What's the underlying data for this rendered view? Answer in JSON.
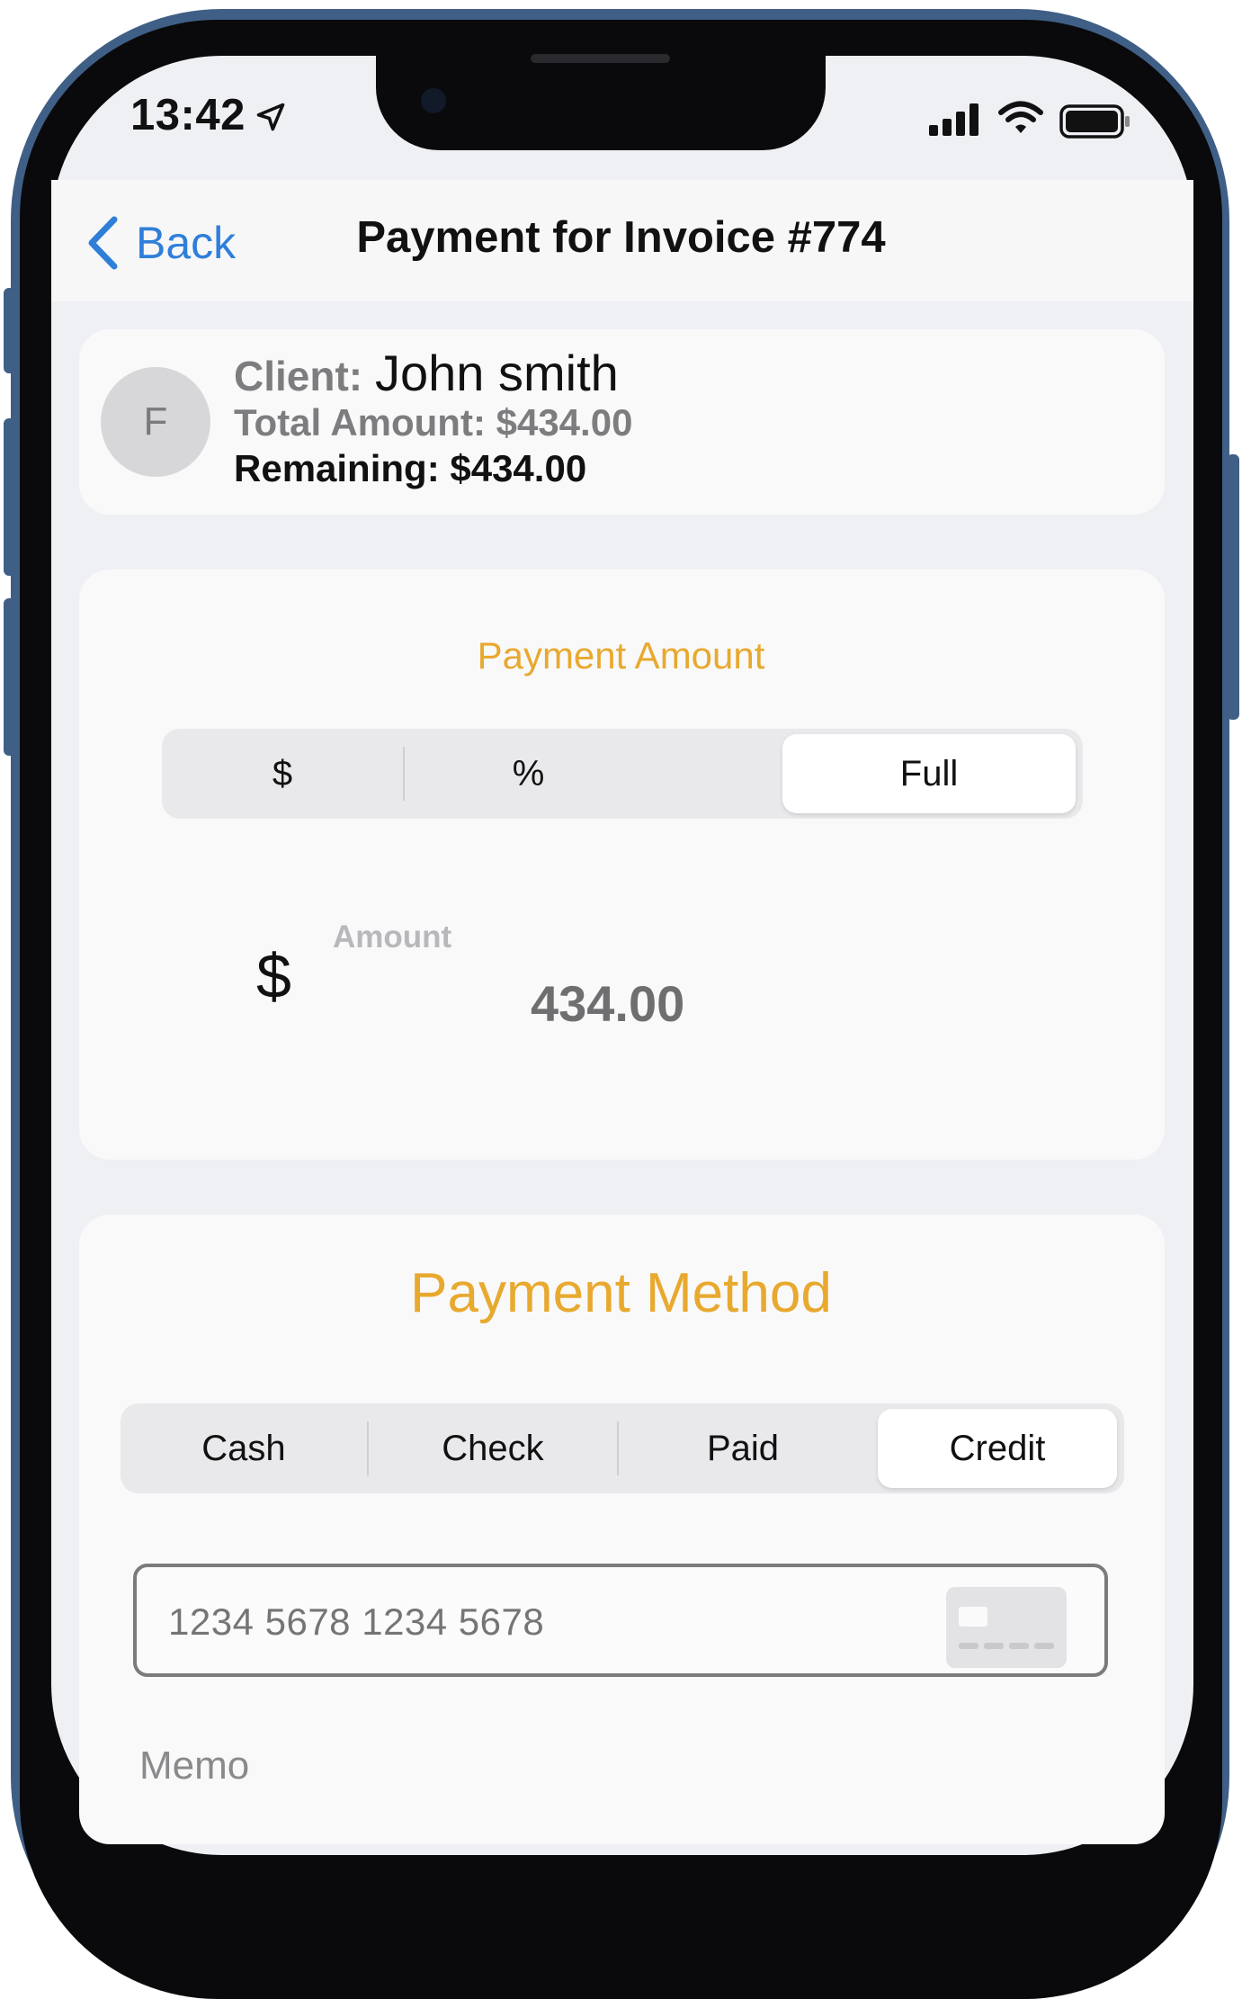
{
  "status_bar": {
    "time": "13:42",
    "icons": [
      "location-arrow-icon",
      "cellular-signal-icon",
      "wifi-icon",
      "battery-icon"
    ]
  },
  "nav": {
    "back_label": "Back",
    "title": "Payment for Invoice #774"
  },
  "client": {
    "avatar_initial": "F",
    "client_label": "Client:",
    "client_name": "John smith",
    "total_label": "Total Amount:",
    "total_value": "$434.00",
    "remaining_label": "Remaining:",
    "remaining_value": "$434.00"
  },
  "payment_amount": {
    "title": "Payment Amount",
    "options": [
      {
        "label": "$",
        "selected": false
      },
      {
        "label": "%",
        "selected": false
      },
      {
        "label": "Full",
        "selected": true
      }
    ],
    "currency_symbol": "$",
    "amount_label": "Amount",
    "amount_value": "434.00"
  },
  "payment_method": {
    "title": "Payment Method",
    "options": [
      {
        "label": "Cash",
        "selected": false
      },
      {
        "label": "Check",
        "selected": false
      },
      {
        "label": "Paid",
        "selected": false
      },
      {
        "label": "Credit",
        "selected": true
      }
    ],
    "card_number_placeholder": "1234 5678 1234 5678",
    "memo_label": "Memo"
  },
  "colors": {
    "accent_orange": "#e8a92f",
    "link_blue": "#2f7fd9",
    "frame_blue": "#3f5f86"
  }
}
